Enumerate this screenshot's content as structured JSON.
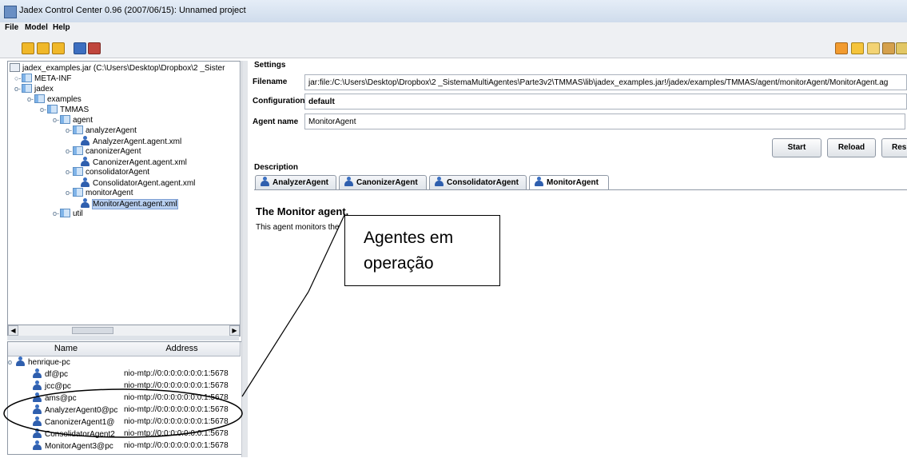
{
  "window": {
    "title": "Jadex Control Center 0.96 (2007/06/15): Unnamed project"
  },
  "menu": [
    "File",
    "Model",
    "Help"
  ],
  "tree": {
    "root": "jadex_examples.jar (C:\\Users\\Desktop\\Dropbox\\2 _Sister",
    "nodes": [
      {
        "label": "META-INF",
        "kind": "package",
        "toggle": "○-"
      },
      {
        "label": "jadex",
        "kind": "package",
        "toggle": "ο-"
      },
      {
        "label": "examples",
        "kind": "package",
        "toggle": "ο-"
      },
      {
        "label": "TMMAS",
        "kind": "package",
        "toggle": "ο-"
      },
      {
        "label": "agent",
        "kind": "package",
        "toggle": "ο-"
      },
      {
        "label": "analyzerAgent",
        "kind": "package",
        "toggle": "ο-"
      },
      {
        "label": "AnalyzerAgent.agent.xml",
        "kind": "agent",
        "toggle": ""
      },
      {
        "label": "canonizerAgent",
        "kind": "package",
        "toggle": "ο-"
      },
      {
        "label": "CanonizerAgent.agent.xml",
        "kind": "agent",
        "toggle": ""
      },
      {
        "label": "consolidatorAgent",
        "kind": "package",
        "toggle": "ο-"
      },
      {
        "label": "ConsolidatorAgent.agent.xml",
        "kind": "agent",
        "toggle": ""
      },
      {
        "label": "monitorAgent",
        "kind": "package",
        "toggle": "ο-"
      },
      {
        "label": "MonitorAgent.agent.xml",
        "kind": "agent",
        "toggle": "",
        "selected": true
      },
      {
        "label": "util",
        "kind": "package",
        "toggle": "ο-"
      }
    ]
  },
  "agents_table": {
    "headers": [
      "Name",
      "Address"
    ],
    "host": "henrique-pc",
    "rows": [
      {
        "name": "df@pc",
        "address": "nio-mtp://0:0:0:0:0:0:0:1:5678"
      },
      {
        "name": "jcc@pc",
        "address": "nio-mtp://0:0:0:0:0:0:0:1:5678"
      },
      {
        "name": "ams@pc",
        "address": "nio-mtp://0:0:0:0:0:0:0:1:5678"
      },
      {
        "name": "AnalyzerAgent0@pc",
        "address": "nio-mtp://0:0:0:0:0:0:0:1:5678"
      },
      {
        "name": "CanonizerAgent1@",
        "address": "nio-mtp://0:0:0:0:0:0:0:1:5678"
      },
      {
        "name": "ConsolidatorAgent2",
        "address": "nio-mtp://0:0:0:0:0:0:0:1:5678"
      },
      {
        "name": "MonitorAgent3@pc",
        "address": "nio-mtp://0:0:0:0:0:0:0:1:5678"
      }
    ]
  },
  "settings": {
    "section": "Settings",
    "filename_label": "Filename",
    "filename_value": "jar:file:/C:\\Users\\Desktop\\Dropbox\\2 _SistemaMultiAgentes\\Parte3v2\\TMMAS\\lib\\jadex_examples.jar!/jadex/examples/TMMAS/agent/monitorAgent/MonitorAgent.ag",
    "configuration_label": "Configuration",
    "configuration_value": "default",
    "agentname_label": "Agent name",
    "agentname_value": "MonitorAgent",
    "buttons": [
      "Start",
      "Reload",
      "Res"
    ]
  },
  "description": {
    "section": "Description",
    "tabs": [
      "AnalyzerAgent",
      "CanonizerAgent",
      "ConsolidatorAgent",
      "MonitorAgent"
    ],
    "active_tab": "MonitorAgent",
    "heading": "The Monitor agent.",
    "body": "This agent monitors the"
  },
  "callout": {
    "text": "Agentes em operação"
  }
}
